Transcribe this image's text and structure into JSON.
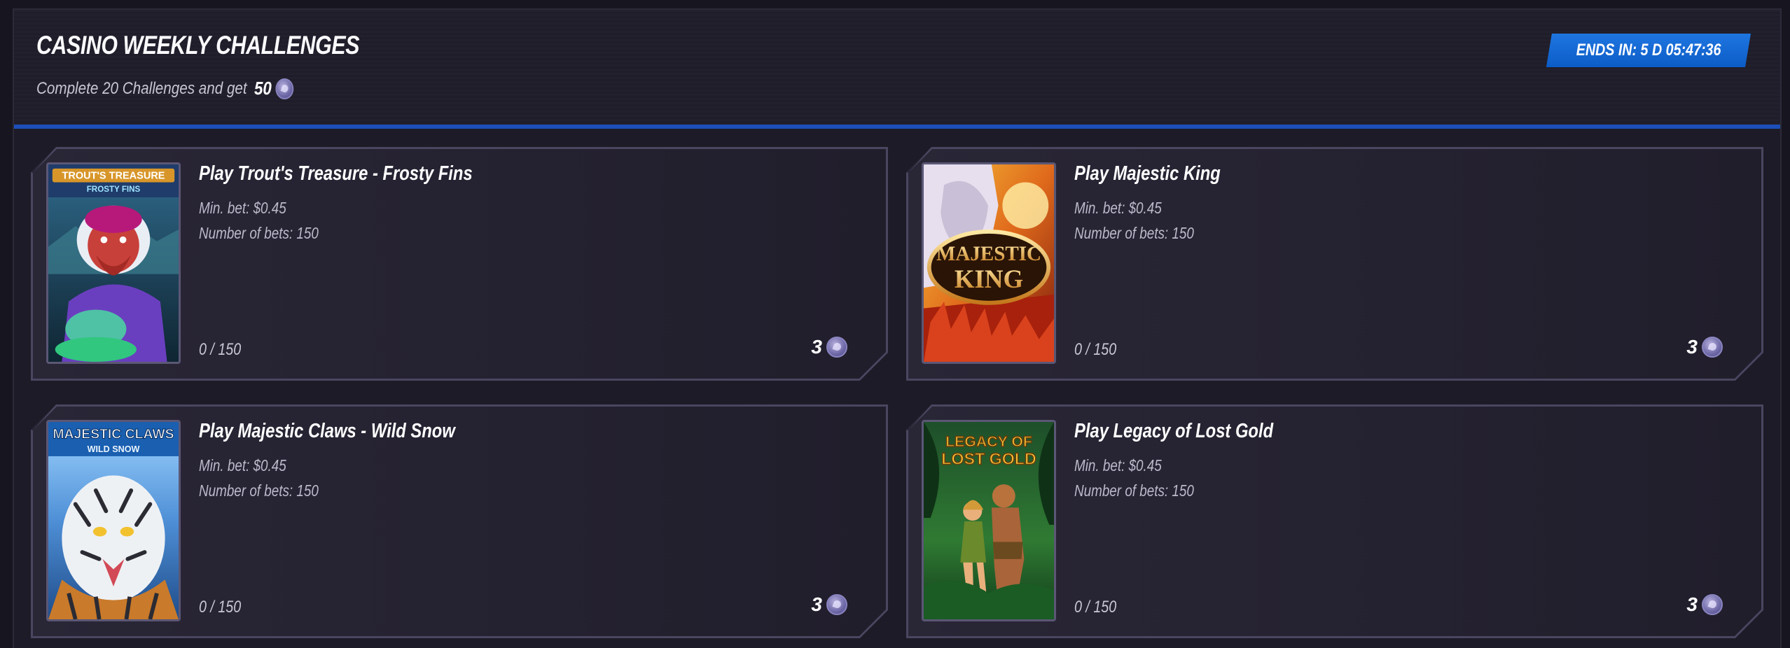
{
  "header": {
    "title": "CASINO WEEKLY CHALLENGES",
    "subtitle": "Complete 20 Challenges and get",
    "reward": "50",
    "reward_icon": "coin-icon",
    "ends_in": "ENDS IN: 5 D 05:47:36"
  },
  "colors": {
    "accent": "#1c4fb8",
    "badge": "#0c5cc7",
    "background": "#1d1b27"
  },
  "challenges": [
    {
      "title": "Play Trout's Treasure - Frosty Fins",
      "min_bet": "Min. bet: $0.45",
      "num_bets": "Number of bets: 150",
      "progress": "0 / 150",
      "reward": "3",
      "game": "Trout's Treasure Frosty Fins",
      "logo_line1": "TROUT'S TREASURE",
      "logo_line2": "FROSTY FINS"
    },
    {
      "title": "Play Majestic King",
      "min_bet": "Min. bet: $0.45",
      "num_bets": "Number of bets: 150",
      "progress": "0 / 150",
      "reward": "3",
      "game": "Majestic King",
      "logo_line1": "MAJESTIC",
      "logo_line2": "KING"
    },
    {
      "title": "Play Majestic Claws - Wild Snow",
      "min_bet": "Min. bet: $0.45",
      "num_bets": "Number of bets: 150",
      "progress": "0 / 150",
      "reward": "3",
      "game": "Majestic Claws Wild Snow",
      "logo_line1": "MAJESTIC CLAWS",
      "logo_line2": "WILD SNOW"
    },
    {
      "title": "Play Legacy of Lost Gold",
      "min_bet": "Min. bet: $0.45",
      "num_bets": "Number of bets: 150",
      "progress": "0 / 150",
      "reward": "3",
      "game": "Legacy of Lost Gold",
      "logo_line1": "LEGACY OF",
      "logo_line2": "LOST GOLD"
    }
  ]
}
